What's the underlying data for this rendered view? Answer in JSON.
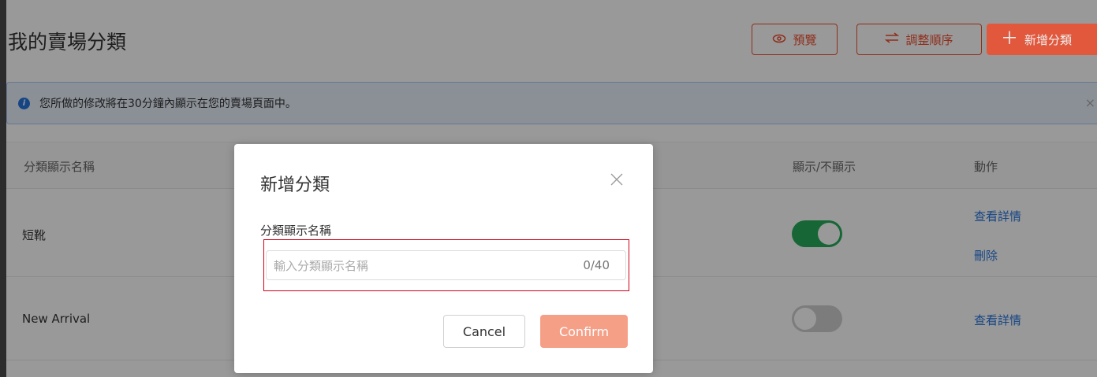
{
  "page": {
    "title": "我的賣場分類",
    "buttons": {
      "preview_label": "預覽",
      "sort_label": "調整順序",
      "add_label": "新增分類"
    }
  },
  "notice": {
    "text": "您所做的修改將在30分鐘內顯示在您的賣場頁面中。",
    "close": "×"
  },
  "table": {
    "headers": {
      "name": "分類顯示名稱",
      "visibility": "顯示/不顯示",
      "action": "動作"
    },
    "rows": [
      {
        "name": "短靴",
        "visible": true,
        "actions": [
          "查看詳情",
          "刪除"
        ]
      },
      {
        "name": "New Arrival",
        "visible": false,
        "actions": [
          "查看詳情"
        ]
      }
    ]
  },
  "modal": {
    "title": "新增分類",
    "field_label": "分類顯示名稱",
    "input_placeholder": "輸入分類顯示名稱",
    "char_count": "0/40",
    "cancel_label": "Cancel",
    "confirm_label": "Confirm"
  },
  "colors": {
    "brand": "#ee4d2d",
    "link": "#2673dd",
    "toggle_on": "#26aa5b",
    "confirm_disabled": "#f69f87",
    "highlight": "#d0021b"
  }
}
